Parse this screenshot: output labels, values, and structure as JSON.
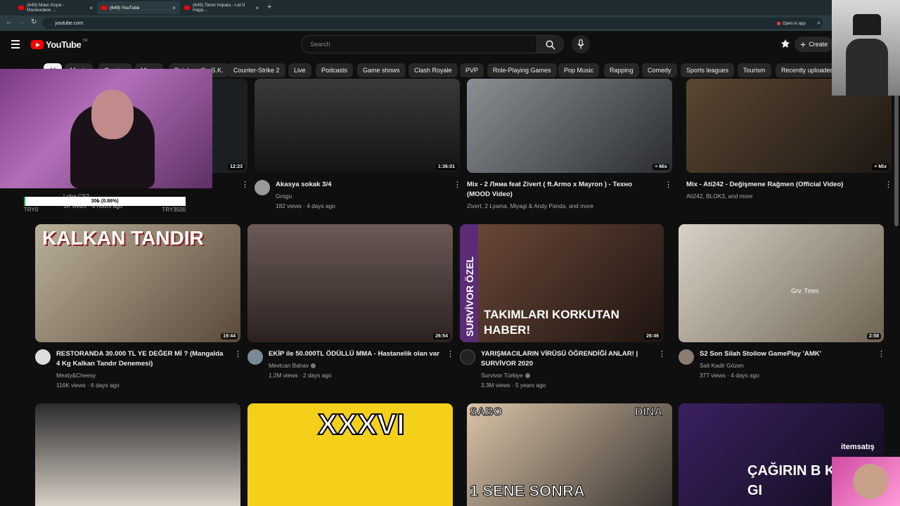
{
  "browser": {
    "tabs": [
      {
        "title": "(649) Макс Корж - Малиновое ...",
        "active": false
      },
      {
        "title": "(649) YouTube",
        "active": true
      },
      {
        "title": "(649) Tame Impala - Let It Happ...",
        "active": false
      }
    ],
    "url": "youtube.com",
    "open_in_app": "Open in app"
  },
  "masthead": {
    "logo_text": "YouTube",
    "country_code": "TR",
    "search_placeholder": "Search",
    "create_label": "Create"
  },
  "chips": [
    "All",
    "Music",
    "Gaming",
    "Mixes",
    "Rainbow Six S.K.",
    "Counter-Strike 2",
    "Live",
    "Podcasts",
    "Game shows",
    "Clash Royale",
    "PVP",
    "Role-Playing Games",
    "Pop Music",
    "Rapping",
    "Comedy",
    "Sports leagues",
    "Tourism",
    "Recently uploaded"
  ],
  "row1": [
    {
      "title": "",
      "channel": "Loba CS2",
      "meta": "1K views · 4 hours ago",
      "duration": "12:23"
    },
    {
      "title": "Akasya sokak 3/4",
      "channel": "Grogu",
      "meta": "182 views · 4 days ago",
      "duration": "1:36:01"
    },
    {
      "title": "Mix - 2 Ляма feat Zivert ( ft.Armo x Mayron ) - Техно (MOOD Video)",
      "channel": "Zivert, 2 Lyama, Miyagi & Andy Panda, and more",
      "meta": "",
      "duration": "Mix"
    },
    {
      "title": "Mix - Ati242 - Değişmene Rağmen (Official Video)",
      "channel": "Ati242, BLOK3, and more",
      "meta": "",
      "duration": "Mix"
    }
  ],
  "row2": [
    {
      "title": "RESTORANDA 30.000 TL YE DEĞER Mİ ? (Mangalda 4 Kg Kalkan Tandır Denemesi)",
      "channel": "Meaty&Cheesy",
      "meta": "116K views · 6 days ago",
      "duration": "19:44",
      "thumb_text": "KALKAN TANDIR",
      "verified": false
    },
    {
      "title": "EKİP ile 50.000TL ÖDÜLLÜ MMA - Hastanelik olan var",
      "channel": "Mevtcan Bahav",
      "meta": "1.2M views · 2 days ago",
      "duration": "26:54",
      "thumb_text": "",
      "verified": true
    },
    {
      "title": "YARIŞMACILARIN VİRÜSÜ ÖĞRENDİĞİ ANLAR! | SURVİVOR 2020",
      "channel": "Survivor Türkiye",
      "meta": "3.3M views · 5 years ago",
      "duration": "26:46",
      "thumb_text": "TAKIMLARI KORKUTAN HABER!",
      "thumb_side": "SURVİVOR ÖZEL",
      "verified": true
    },
    {
      "title": "S2 Son Silah Stoilow GamePlay 'AMK'",
      "channel": "Sait Kadir Gözen",
      "meta": "377 views · 4 days ago",
      "duration": "2:58",
      "thumb_text": "Grv. Tmm",
      "verified": false
    }
  ],
  "row3": [
    {
      "thumb_text": ""
    },
    {
      "thumb_text": "XXXVI"
    },
    {
      "thumb_text": "1 SENE SONRA",
      "left_name": "SABO",
      "right_name": "DINA"
    },
    {
      "thumb_text": "ÇAĞIRIN B KADINI GI"
    }
  ],
  "overlay": {
    "donation_text": "30₺ (0.86%)",
    "donation_progress": 0.0086,
    "donation_left": "TRY0",
    "donation_right": "TRY3500",
    "watermark": "itemsatış"
  },
  "colors": {
    "background": "#0f0f0f",
    "accent": "#ff0000",
    "chip": "#272727"
  }
}
